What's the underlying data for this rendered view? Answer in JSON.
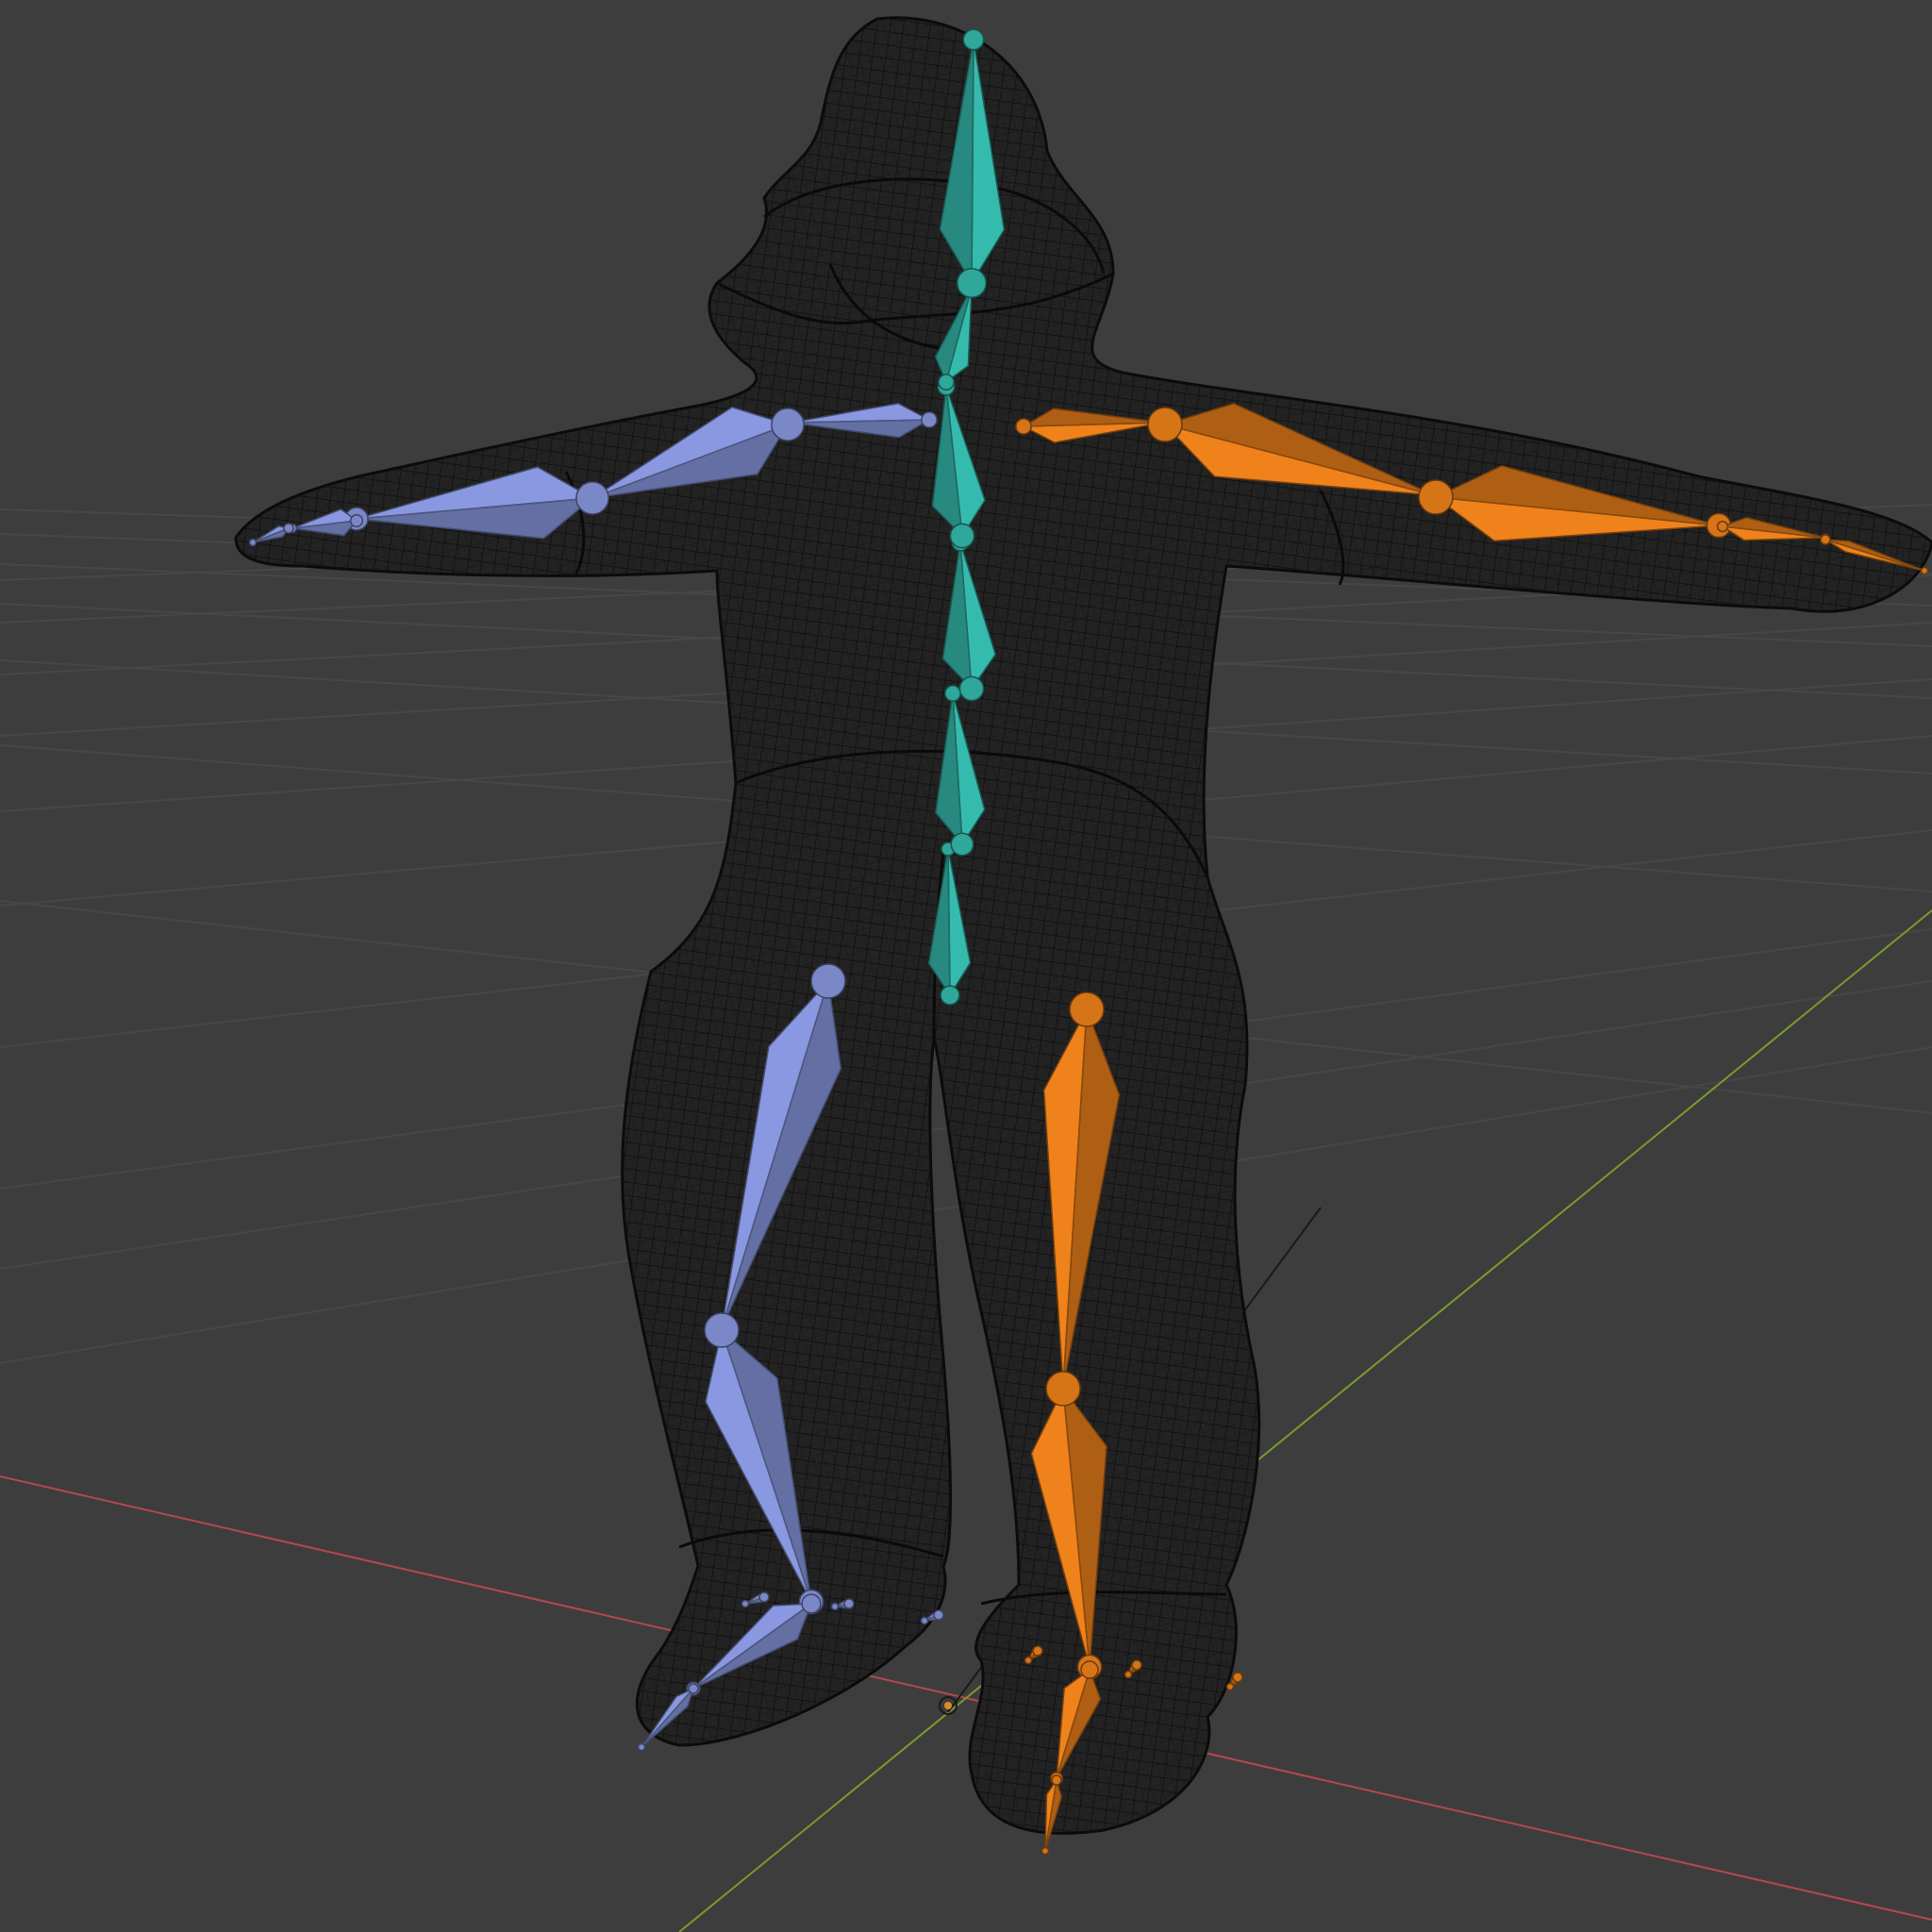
{
  "viewport": {
    "background": "#3d3d3d",
    "grid_color": "#4a4a4a",
    "axis_x_color": "#b5474e",
    "axis_y_color": "#7c9a2e",
    "mesh_color": "#111111"
  },
  "rig": {
    "spine_color": "#2fa79b",
    "left_side_color": "#7a88c8",
    "right_side_color": "#d67418"
  }
}
